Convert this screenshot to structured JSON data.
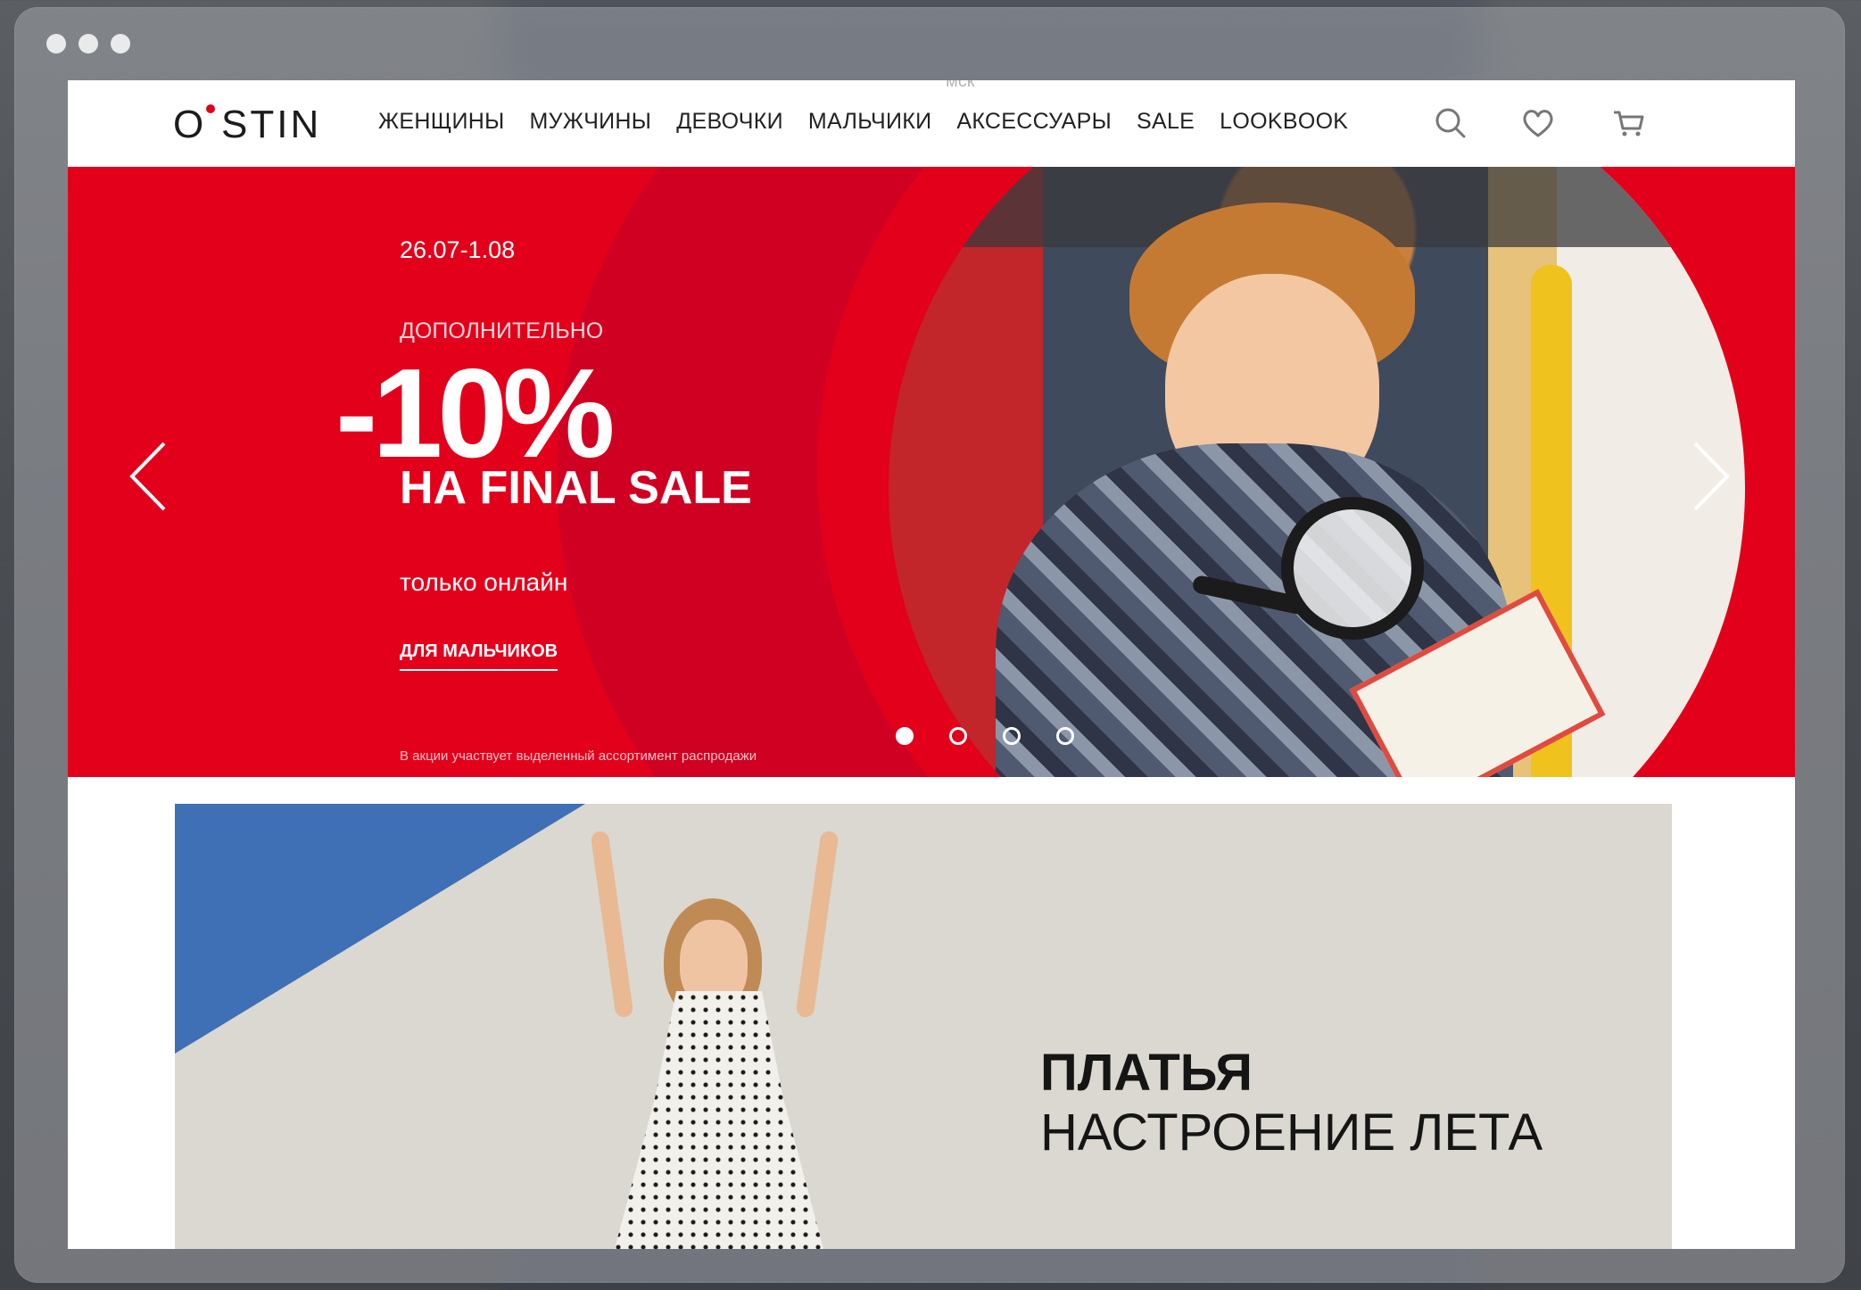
{
  "header": {
    "city": "мск",
    "logo": "O'STIN",
    "nav": [
      "ЖЕНЩИНЫ",
      "МУЖЧИНЫ",
      "ДЕВОЧКИ",
      "МАЛЬЧИКИ",
      "АКСЕССУАРЫ",
      "SALE",
      "LOOKBOOK"
    ],
    "icons": [
      "search-icon",
      "heart-icon",
      "cart-icon"
    ]
  },
  "hero": {
    "date": "26.07-1.08",
    "extra": "ДОПОЛНИТЕЛЬНО",
    "percent": "-10%",
    "final_sale": "НА FINAL SALE",
    "online": "только онлайн",
    "link": "ДЛЯ МАЛЬЧИКОВ",
    "note": "В акции участвует выделенный ассортимент распродажи",
    "slides": 4,
    "active_slide": 1,
    "colors": {
      "red": "#e3001b",
      "dark_red": "#d00022"
    }
  },
  "banner2": {
    "title": "ПЛАТЬЯ",
    "subtitle": "НАСТРОЕНИЕ ЛЕТА"
  }
}
